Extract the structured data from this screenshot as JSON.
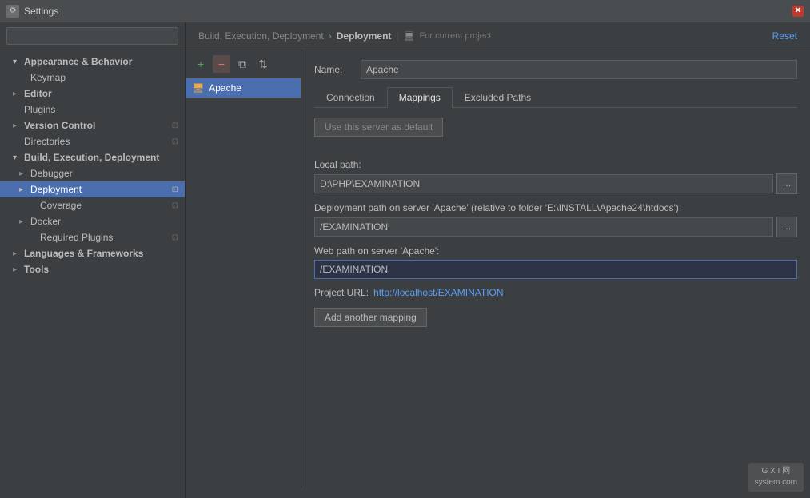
{
  "titlebar": {
    "title": "Settings",
    "icon": "⚙"
  },
  "search": {
    "placeholder": "Q",
    "value": ""
  },
  "sidebar": {
    "items": [
      {
        "id": "appearance",
        "label": "Appearance & Behavior",
        "level": 0,
        "hasArrow": true,
        "arrowOpen": true,
        "bold": true
      },
      {
        "id": "keymap",
        "label": "Keymap",
        "level": 1,
        "hasArrow": false,
        "bold": false
      },
      {
        "id": "editor",
        "label": "Editor",
        "level": 0,
        "hasArrow": true,
        "arrowOpen": false,
        "bold": true
      },
      {
        "id": "plugins",
        "label": "Plugins",
        "level": 0,
        "hasArrow": false,
        "bold": false
      },
      {
        "id": "version-control",
        "label": "Version Control",
        "level": 0,
        "hasArrow": true,
        "arrowOpen": false,
        "bold": true
      },
      {
        "id": "directories",
        "label": "Directories",
        "level": 0,
        "hasArrow": false,
        "bold": false
      },
      {
        "id": "build",
        "label": "Build, Execution, Deployment",
        "level": 0,
        "hasArrow": true,
        "arrowOpen": true,
        "bold": true
      },
      {
        "id": "debugger",
        "label": "Debugger",
        "level": 1,
        "hasArrow": true,
        "arrowOpen": false,
        "bold": false
      },
      {
        "id": "deployment",
        "label": "Deployment",
        "level": 1,
        "hasArrow": true,
        "arrowOpen": false,
        "bold": false,
        "selected": true
      },
      {
        "id": "coverage",
        "label": "Coverage",
        "level": 2,
        "hasArrow": false,
        "bold": false
      },
      {
        "id": "docker",
        "label": "Docker",
        "level": 1,
        "hasArrow": true,
        "arrowOpen": false,
        "bold": false
      },
      {
        "id": "required-plugins",
        "label": "Required Plugins",
        "level": 2,
        "hasArrow": false,
        "bold": false
      },
      {
        "id": "languages",
        "label": "Languages & Frameworks",
        "level": 0,
        "hasArrow": true,
        "arrowOpen": false,
        "bold": true
      },
      {
        "id": "tools",
        "label": "Tools",
        "level": 0,
        "hasArrow": true,
        "arrowOpen": false,
        "bold": true
      }
    ]
  },
  "header": {
    "breadcrumb_part1": "Build, Execution, Deployment",
    "breadcrumb_arrow": "›",
    "breadcrumb_part2": "Deployment",
    "project_label": "For current project",
    "reset_label": "Reset"
  },
  "toolbar": {
    "add_title": "+",
    "remove_title": "−",
    "copy_title": "⧉",
    "move_title": "⇅"
  },
  "server": {
    "name": "Apache",
    "icon": "🖥"
  },
  "detail": {
    "name_label": "Name:",
    "name_value": "Apache",
    "tabs": [
      {
        "id": "connection",
        "label": "Connection"
      },
      {
        "id": "mappings",
        "label": "Mappings",
        "active": true
      },
      {
        "id": "excluded-paths",
        "label": "Excluded Paths"
      }
    ],
    "default_btn_label": "Use this server as default",
    "local_path_label": "Local path:",
    "local_path_value": "D:\\PHP\\EXAMINATION",
    "deployment_path_label": "Deployment path on server 'Apache' (relative to folder 'E:\\INSTALL\\Apache24\\htdocs'):",
    "deployment_path_value": "/EXAMINATION",
    "web_path_label": "Web path on server 'Apache':",
    "web_path_value": "/EXAMINATION",
    "project_url_label": "Project URL:",
    "project_url_value": "http://localhost/EXAMINATION",
    "add_mapping_label": "Add another mapping"
  },
  "watermark": "G X I 网\nsystem.com"
}
